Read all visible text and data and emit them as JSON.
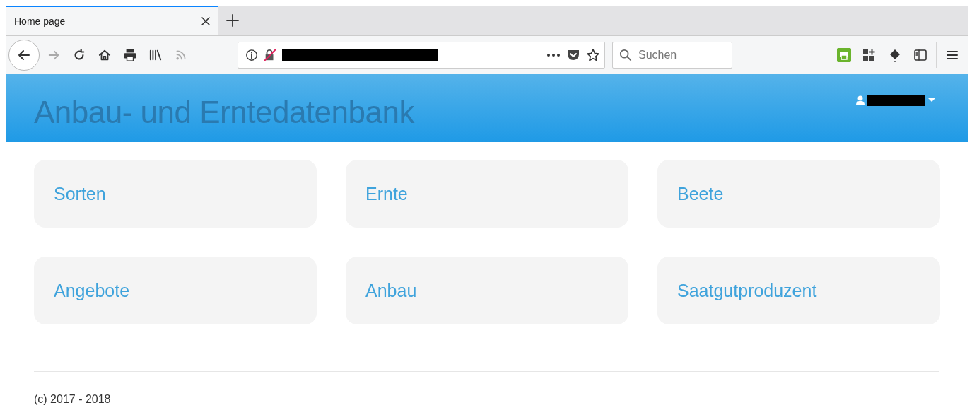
{
  "browser": {
    "tabs": [
      {
        "title": "Home page",
        "selected": true
      }
    ],
    "search": {
      "placeholder": "Suchen"
    }
  },
  "header": {
    "title": "Anbau- und Erntedatenbank"
  },
  "tiles": [
    {
      "label": "Sorten"
    },
    {
      "label": "Ernte"
    },
    {
      "label": "Beete"
    },
    {
      "label": "Angebote"
    },
    {
      "label": "Anbau"
    },
    {
      "label": "Saatgutproduzent"
    }
  ],
  "footer": {
    "text": "(c) 2017 - 2018"
  }
}
